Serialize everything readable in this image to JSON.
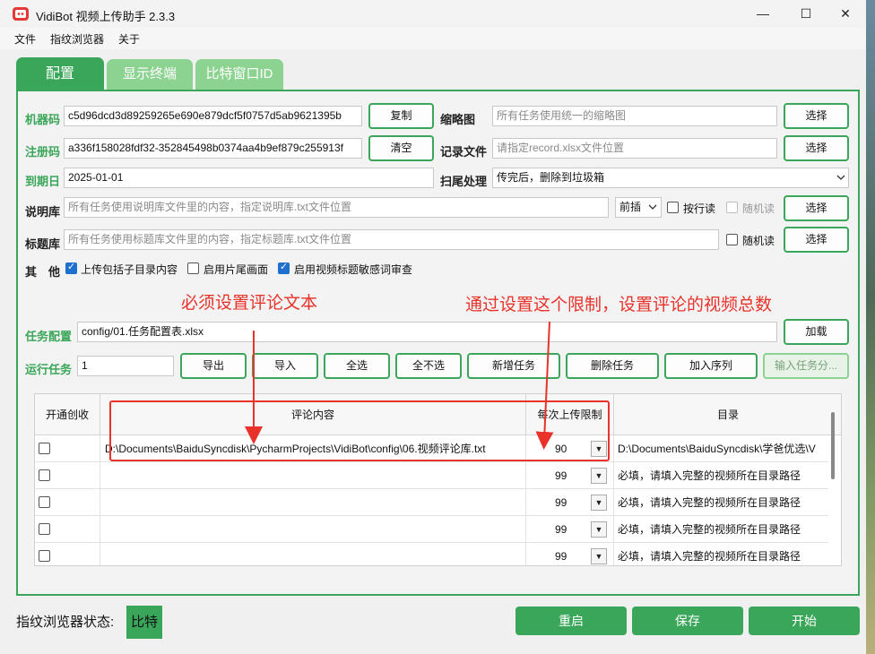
{
  "window": {
    "title": "VidiBot 视频上传助手 2.3.3",
    "min": "—",
    "max": "☐",
    "close": "✕"
  },
  "menu": [
    "文件",
    "指纹浏览器",
    "关于"
  ],
  "tabs": [
    "配置",
    "显示终端",
    "比特窗口ID"
  ],
  "form": {
    "machine_code": {
      "label": "机器码",
      "value": "c5d96dcd3d89259265e690e879dcf5f0757d5ab9621395b",
      "button": "复制"
    },
    "reg_code": {
      "label": "注册码",
      "value": "a336f158028fdf32-352845498b0374aa4b9ef879c255913f",
      "button": "清空"
    },
    "expiry": {
      "label": "到期日",
      "value": "2025-01-01"
    },
    "thumbnail": {
      "label": "缩略图",
      "placeholder": "所有任务使用统一的缩略图",
      "button": "选择"
    },
    "record_file": {
      "label": "记录文件",
      "placeholder": "请指定record.xlsx文件位置",
      "button": "选择"
    },
    "tail_action": {
      "label": "扫尾处理",
      "value": "传完后，删除到垃圾箱"
    },
    "desc_lib": {
      "label": "说明库",
      "placeholder": "所有任务使用说明库文件里的内容，指定说明库.txt文件位置",
      "position": "前插",
      "by_line": "按行读",
      "random": "随机读",
      "button": "选择"
    },
    "title_lib": {
      "label": "标题库",
      "placeholder": "所有任务使用标题库文件里的内容，指定标题库.txt文件位置",
      "random": "随机读",
      "button": "选择"
    },
    "other": {
      "label": "其　他",
      "opt1": "上传包括子目录内容",
      "opt2": "启用片尾画面",
      "opt3": "启用视频标题敏感词审查"
    },
    "task_config": {
      "label": "任务配置",
      "value": "config/01.任务配置表.xlsx",
      "button": "加载"
    },
    "run_task": {
      "label": "运行任务",
      "value": "1"
    }
  },
  "actions": [
    "导出",
    "导入",
    "全选",
    "全不选",
    "新增任务",
    "删除任务",
    "加入序列",
    "输入任务分..."
  ],
  "annotations": {
    "left": "必须设置评论文本",
    "right": "通过设置这个限制，设置评论的视频总数"
  },
  "table": {
    "headers": [
      "开通创收",
      "评论内容",
      "每次上传限制",
      "目录"
    ],
    "rows": [
      {
        "comment": "D:\\Documents\\BaiduSyncdisk\\PycharmProjects\\VidiBot\\config\\06.视频评论库.txt",
        "limit": "90",
        "dir": "D:\\Documents\\BaiduSyncdisk\\学爸优选\\V"
      },
      {
        "comment": "",
        "limit": "99",
        "dir": "必填，请填入完整的视频所在目录路径"
      },
      {
        "comment": "",
        "limit": "99",
        "dir": "必填，请填入完整的视频所在目录路径"
      },
      {
        "comment": "",
        "limit": "99",
        "dir": "必填，请填入完整的视频所在目录路径"
      },
      {
        "comment": "",
        "limit": "99",
        "dir": "必填，请填入完整的视频所在目录路径"
      }
    ]
  },
  "status": {
    "label": "指纹浏览器状态:",
    "value": "比特"
  },
  "bottom_buttons": [
    "重启",
    "保存",
    "开始"
  ],
  "colors": {
    "accent": "#3aa659",
    "accent_light": "#8cd391",
    "annotation": "#e8322a"
  }
}
